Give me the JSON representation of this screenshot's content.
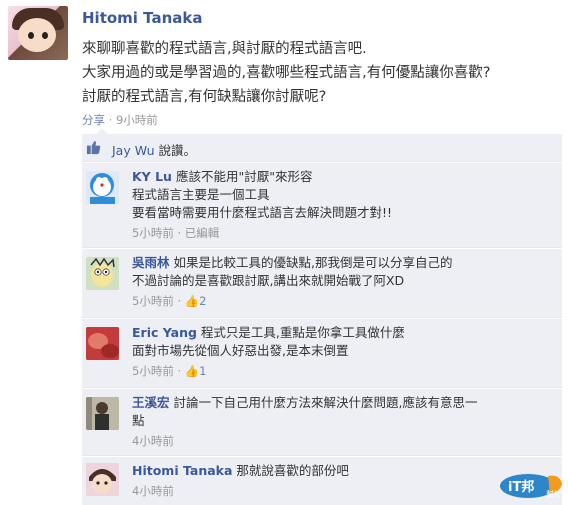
{
  "post": {
    "author": "Hitomi Tanaka",
    "lines": [
      "來聊聊喜歡的程式語言,與討厭的程式語言吧.",
      "大家用過的或是學習過的,喜歡哪些程式語言,有何優點讓你喜歡?",
      "討厭的程式語言,有何缺點讓你討厭呢?"
    ],
    "share_label": "分享",
    "separator": " · ",
    "time": "9小時前"
  },
  "likes": {
    "who": "Jay Wu",
    "suffix": " 說讚。"
  },
  "comments": [
    {
      "author": "KY Lu",
      "lines": [
        "應該不能用\"討厭\"來形容",
        "程式語言主要是一個工具",
        "要看當時需要用什麼程式語言去解決問題才對!!"
      ],
      "meta": "5小時前 · 已編輯",
      "likes": ""
    },
    {
      "author": "吳雨林",
      "lines": [
        "如果是比較工具的優缺點,那我倒是可以分享自己的",
        "不過討論的是喜歡跟討厭,講出來就開始戰了阿XD"
      ],
      "meta": "5小時前 · ",
      "likes": "2"
    },
    {
      "author": "Eric Yang",
      "lines": [
        "程式只是工具,重點是你拿工具做什麼",
        "面對市場先從個人好惡出發,是本末倒置"
      ],
      "meta": "5小時前 · ",
      "likes": "1"
    },
    {
      "author": "王溪宏",
      "lines": [
        "討論一下自己用什麼方法來解決什麼問題,應該有意思一",
        "點"
      ],
      "meta": "4小時前",
      "likes": ""
    },
    {
      "author": "Hitomi Tanaka",
      "lines": [
        "那就說喜歡的部份吧"
      ],
      "meta": "4小時前",
      "likes": ""
    }
  ],
  "watermark": {
    "text_main": "iT邦",
    "text_sub": "幫忙"
  },
  "colors": {
    "link": "#3b5998",
    "meta": "#999999",
    "thread_bg": "#edeff4"
  }
}
